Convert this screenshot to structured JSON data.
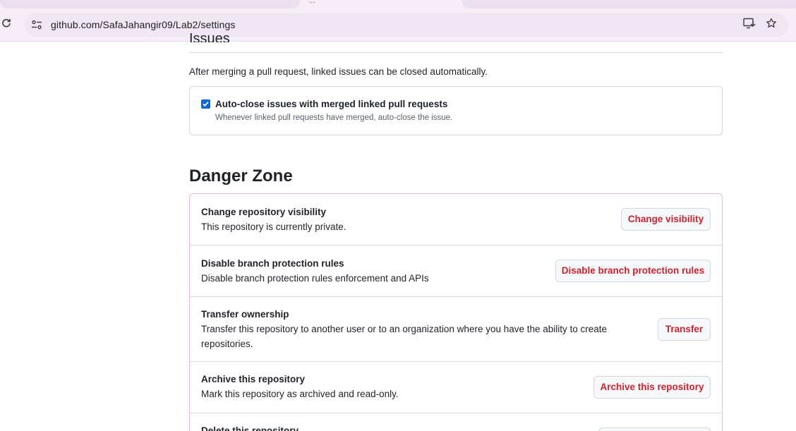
{
  "browser": {
    "url": "github.com/SafaJahangir09/Lab2/settings",
    "tab_mark": "…"
  },
  "issues": {
    "heading": "Issues",
    "description": "After merging a pull request, linked issues can be closed automatically.",
    "autoclose": {
      "checked": true,
      "label": "Auto-close issues with merged linked pull requests",
      "note": "Whenever linked pull requests have merged, auto-close the issue."
    }
  },
  "danger_zone": {
    "title": "Danger Zone",
    "rows": [
      {
        "title": "Change repository visibility",
        "description": "This repository is currently private.",
        "button": "Change visibility"
      },
      {
        "title": "Disable branch protection rules",
        "description": "Disable branch protection rules enforcement and APIs",
        "button": "Disable branch protection rules"
      },
      {
        "title": "Transfer ownership",
        "description": "Transfer this repository to another user or to an organization where you have the ability to create repositories.",
        "button": "Transfer"
      },
      {
        "title": "Archive this repository",
        "description": "Mark this repository as archived and read-only.",
        "button": "Archive this repository"
      },
      {
        "title": "Delete this repository",
        "description": "",
        "button": ""
      }
    ]
  },
  "colors": {
    "danger_text": "#cf222e",
    "danger_border": "#f0b8c0",
    "checkbox": "#0969da",
    "chrome_bg": "#f5eef6"
  },
  "icons": [
    "reload-icon",
    "site-settings-icon",
    "install-app-icon",
    "bookmark-star-icon",
    "checkmark-icon"
  ]
}
